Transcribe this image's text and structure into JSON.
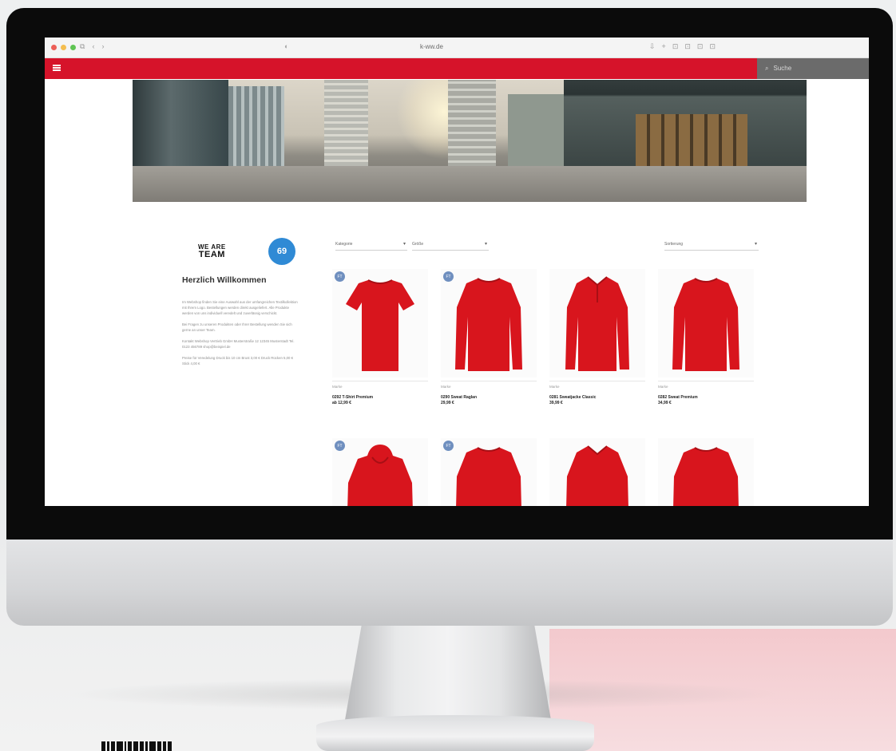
{
  "browser": {
    "url": "k-ww.de",
    "nav_glyphs": [
      "⧉",
      "‹",
      "›"
    ],
    "tool_glyphs": [
      "⇩",
      "+",
      "⊡",
      "⊡",
      "⊡",
      "⊡"
    ]
  },
  "header": {
    "search_placeholder": "Suche",
    "search_icon": "search-icon"
  },
  "sidebar": {
    "logo_left_line1": "WE ARE",
    "logo_left_line2": "TEAM",
    "logo_right": "69",
    "welcome_title": "Herzlich Willkommen",
    "paragraphs": [
      "Im Webshop finden Sie eine Auswahl aus der umfangreichen Textilkollektion mit Ihrem Logo. Bestellungen werden direkt ausgeliefert. Alle Produkte werden von uns individuell veredelt und zuverlässig verschickt.",
      "Bei Fragen zu unseren Produkten oder Ihrer Bestellung wenden Sie sich gerne an unser Team.",
      "Kontakt Webshop Vertrieb GmbH Musterstraße 12 12345 Musterstadt Tel. 0123 456789 shop@beispiel.de",
      "Preise für Veredelung Druck bis 10 cm Brust 3,00 € Druck Rücken 5,00 € Stick 4,00 €"
    ]
  },
  "filters": {
    "category": "Kategorie",
    "size": "Größe",
    "sort": "Sortierung"
  },
  "products": [
    {
      "brand": "Marke",
      "name": "0292 T-Shirt Premium",
      "price": "ab 12,99 €",
      "badge": "FT",
      "type": "tshirt"
    },
    {
      "brand": "Marke",
      "name": "0290 Sweat Raglan",
      "price": "29,99 €",
      "badge": "FT",
      "type": "longsleeve"
    },
    {
      "brand": "Marke",
      "name": "0281 Sweatjacke Classic",
      "price": "39,99 €",
      "badge": "",
      "type": "polo"
    },
    {
      "brand": "Marke",
      "name": "0282 Sweat Premium",
      "price": "34,99 €",
      "badge": "",
      "type": "longsleeve"
    },
    {
      "brand": "",
      "name": "",
      "price": "",
      "badge": "FT",
      "type": "hoodie"
    },
    {
      "brand": "",
      "name": "",
      "price": "",
      "badge": "FT",
      "type": "longsleeve"
    },
    {
      "brand": "",
      "name": "",
      "price": "",
      "badge": "",
      "type": "polo"
    },
    {
      "brand": "",
      "name": "",
      "price": "",
      "badge": "",
      "type": "longsleeve"
    }
  ],
  "colors": {
    "brand_red": "#d6132a",
    "garment_red": "#d8151d",
    "search_bg": "#6b6b6b"
  }
}
